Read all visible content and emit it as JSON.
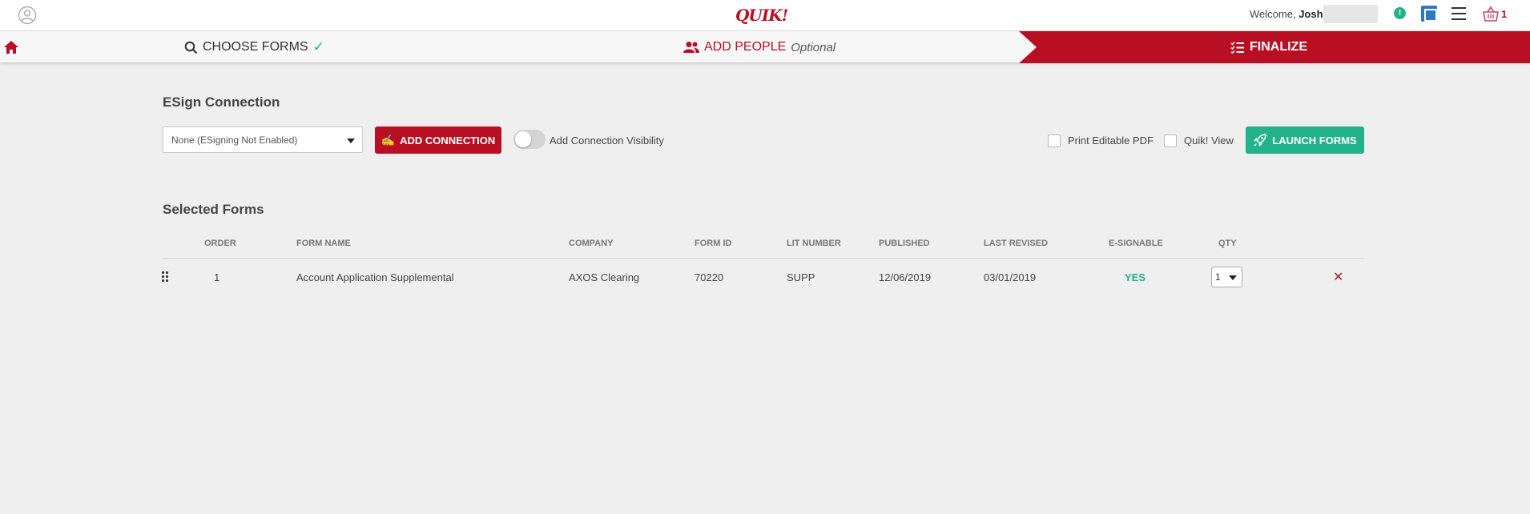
{
  "header": {
    "logo_text": "QUIK!",
    "welcome_label": "Welcome,",
    "user_name": "Josh",
    "alert_badge": "!",
    "cart_count": "1"
  },
  "steps": {
    "choose": "CHOOSE FORMS",
    "add_people": "ADD PEOPLE",
    "add_people_note": "Optional",
    "finalize": "FINALIZE"
  },
  "esign": {
    "title": "ESign Connection",
    "connection_value": "None (ESigning Not Enabled)",
    "add_connection_label": "ADD CONNECTION",
    "visibility_label": "Add Connection Visibility",
    "print_pdf_label": "Print Editable PDF",
    "quik_view_label": "Quik! View",
    "launch_label": "LAUNCH FORMS"
  },
  "forms": {
    "title": "Selected Forms",
    "columns": [
      "ORDER",
      "FORM NAME",
      "COMPANY",
      "FORM ID",
      "LIT NUMBER",
      "PUBLISHED",
      "LAST REVISED",
      "E-SIGNABLE",
      "QTY"
    ],
    "rows": [
      {
        "order": "1",
        "form_name": "Account Application Supplemental",
        "company": "AXOS Clearing",
        "form_id": "70220",
        "lit_number": "SUPP",
        "published": "12/06/2019",
        "last_revised": "03/01/2019",
        "esignable": "YES",
        "qty": "1"
      }
    ]
  },
  "colors": {
    "brand_red": "#b90f23",
    "accent_teal": "#22b38a",
    "background": "#efefef"
  },
  "icons": [
    "user-circle-icon",
    "alert-icon",
    "document-icon",
    "hamburger-menu-icon",
    "basket-icon",
    "home-icon",
    "search-icon",
    "checkmark-icon",
    "users-icon",
    "checklist-icon",
    "signature-icon",
    "rocket-icon",
    "drag-handle-icon",
    "close-icon"
  ]
}
